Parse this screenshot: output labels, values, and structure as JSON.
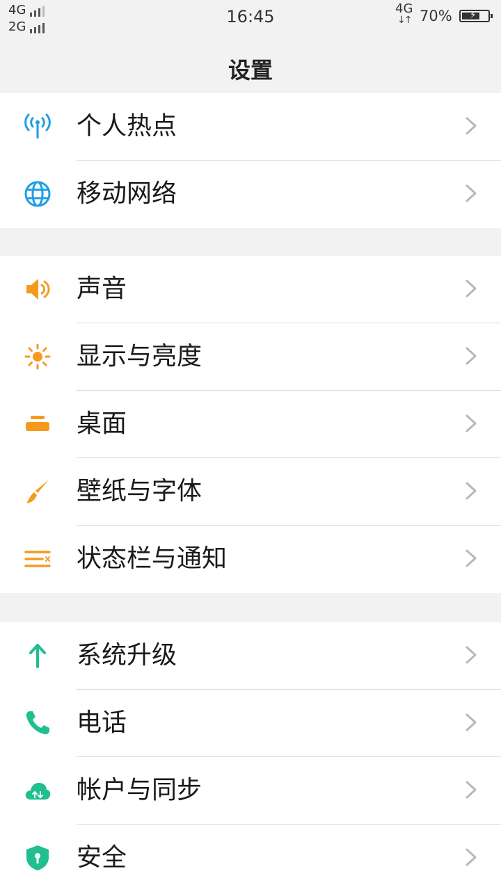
{
  "status_bar": {
    "sim1": "4G",
    "sim2": "2G",
    "time": "16:45",
    "data_network": "4G",
    "data_arrows": "↓↑",
    "battery_percent": "70%",
    "battery_level": 0.7
  },
  "header": {
    "title": "设置"
  },
  "groups": [
    {
      "items": [
        {
          "label": "个人热点",
          "icon": "hotspot-icon",
          "color": "#1e9ee5"
        },
        {
          "label": "移动网络",
          "icon": "globe-icon",
          "color": "#1e9ee5"
        }
      ]
    },
    {
      "items": [
        {
          "label": "声音",
          "icon": "speaker-icon",
          "color": "#f59a1f"
        },
        {
          "label": "显示与亮度",
          "icon": "sun-icon",
          "color": "#f59a1f"
        },
        {
          "label": "桌面",
          "icon": "desktop-icon",
          "color": "#f59a1f"
        },
        {
          "label": "壁纸与字体",
          "icon": "brush-icon",
          "color": "#f59a1f"
        },
        {
          "label": "状态栏与通知",
          "icon": "statusbar-icon",
          "color": "#f59a1f"
        }
      ]
    },
    {
      "items": [
        {
          "label": "系统升级",
          "icon": "arrow-up-icon",
          "color": "#1fbf8f"
        },
        {
          "label": "电话",
          "icon": "phone-icon",
          "color": "#1fbf8f"
        },
        {
          "label": "帐户与同步",
          "icon": "cloud-sync-icon",
          "color": "#1fbf8f"
        },
        {
          "label": "安全",
          "icon": "shield-icon",
          "color": "#1fbf8f"
        }
      ]
    }
  ],
  "chevron_color": "#b8b8b8"
}
